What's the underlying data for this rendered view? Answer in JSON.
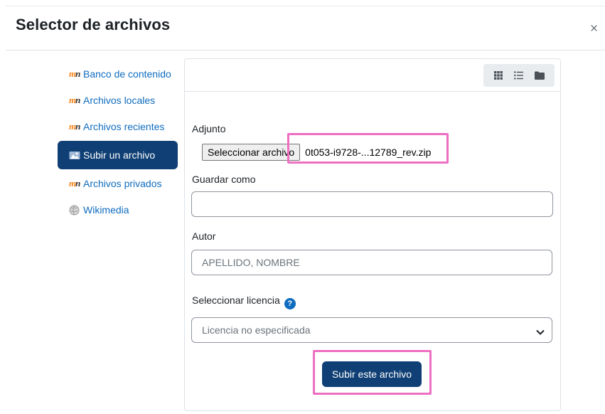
{
  "dialog": {
    "title": "Selector de archivos",
    "close_glyph": "×"
  },
  "sidebar": {
    "items": [
      {
        "label": "Banco de contenido",
        "icon": "moodle-icon",
        "active": false
      },
      {
        "label": "Archivos locales",
        "icon": "moodle-icon",
        "active": false
      },
      {
        "label": "Archivos recientes",
        "icon": "moodle-icon",
        "active": false
      },
      {
        "label": "Subir un archivo",
        "icon": "upload-icon",
        "active": true
      },
      {
        "label": "Archivos privados",
        "icon": "moodle-icon",
        "active": false
      },
      {
        "label": "Wikimedia",
        "icon": "wikimedia-icon",
        "active": false
      }
    ]
  },
  "toolbar": {
    "views": [
      "icons-view-icon",
      "list-view-icon",
      "tree-view-icon"
    ]
  },
  "form": {
    "attachment_label": "Adjunto",
    "file_button": "Seleccionar archivo",
    "file_name": "0t053-i9728-...12789_rev.zip",
    "save_as_label": "Guardar como",
    "save_as_value": "",
    "author_label": "Autor",
    "author_value": "APELLIDO, NOMBRE",
    "license_label": "Seleccionar licencia",
    "license_value": "Licencia no especificada",
    "submit_label": "Subir este archivo"
  },
  "colors": {
    "primary": "#0f3f74",
    "link": "#0f6cbf",
    "highlight": "#ee6ec2"
  }
}
